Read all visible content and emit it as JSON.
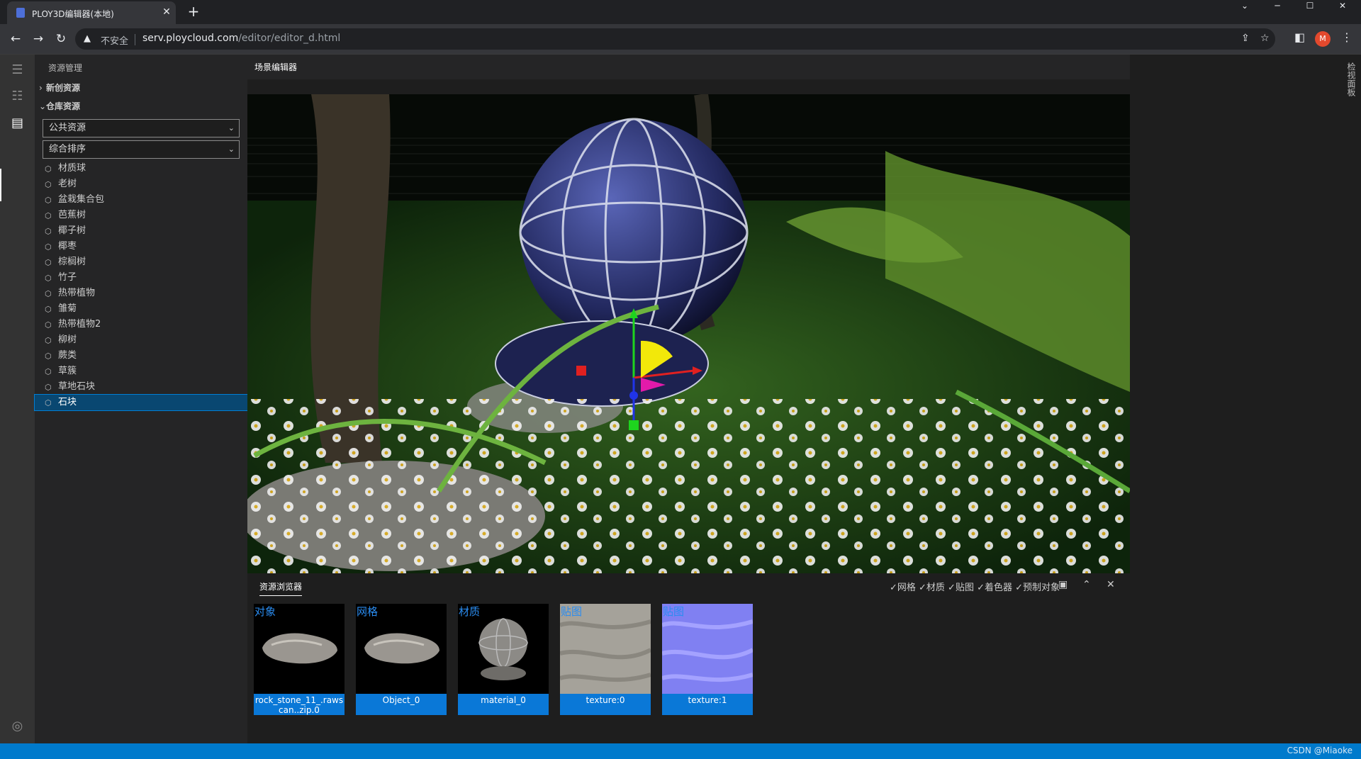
{
  "browser": {
    "tab_title": "PLOY3D编辑器(本地)",
    "tab_close": "✕",
    "new_tab": "+",
    "security_label": "不安全",
    "url_host": "serv.ploycloud.com",
    "url_path": "/editor/editor_d.html",
    "profile_initial": "M"
  },
  "sidebar": {
    "title": "资源管理",
    "section_new": "新创资源",
    "section_repo": "仓库资源",
    "source_select": "公共资源",
    "sort_select": "综合排序",
    "items": [
      {
        "label": "材质球"
      },
      {
        "label": "老树"
      },
      {
        "label": "盆栽集合包"
      },
      {
        "label": "芭蕉树"
      },
      {
        "label": "椰子树"
      },
      {
        "label": "椰枣"
      },
      {
        "label": "棕榈树"
      },
      {
        "label": "竹子"
      },
      {
        "label": "热带植物"
      },
      {
        "label": "雏菊"
      },
      {
        "label": "热带植物2"
      },
      {
        "label": "柳树"
      },
      {
        "label": "蕨类"
      },
      {
        "label": "草簇"
      },
      {
        "label": "草地石块"
      },
      {
        "label": "石块"
      }
    ],
    "selected_index": 15
  },
  "editor": {
    "tab_label": "场景编辑器"
  },
  "asset_browser": {
    "tab_label": "资源浏览器",
    "filters": "✓网格 ✓材质 ✓贴图 ✓着色器 ✓预制对象",
    "cards": [
      {
        "type": "对象",
        "label": "rock_stone_11_.rawscan..zip.0"
      },
      {
        "type": "网格",
        "label": "Object_0"
      },
      {
        "type": "材质",
        "label": "material_0"
      },
      {
        "type": "贴图",
        "label": "texture:0"
      },
      {
        "type": "贴图",
        "label": "texture:1"
      }
    ]
  },
  "inspector": {
    "tab_label": "检视面板"
  },
  "status": {
    "right_text": "CSDN @Miaoke"
  },
  "colors": {
    "accent": "#007acc",
    "selection": "#094771",
    "card_label_bg": "#0a78d7",
    "card_type_text": "#2a8cf0"
  }
}
